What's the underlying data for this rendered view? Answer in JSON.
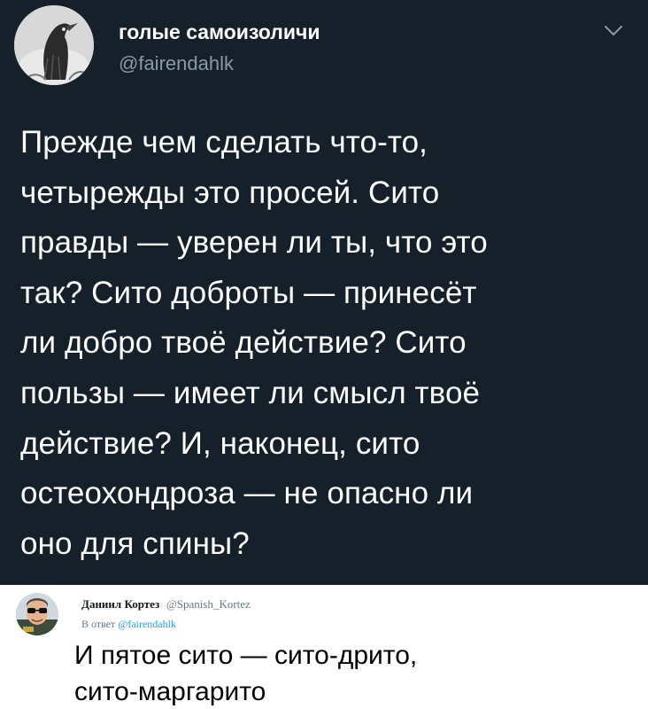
{
  "tweet": {
    "author": {
      "name": "голые самоизоличи",
      "handle": "@fairendahlk",
      "avatar_icon": "bird-avatar-icon"
    },
    "menu_icon": "chevron-down-icon",
    "text_lines": [
      "Прежде чем сделать что-то,",
      "четырежды это просей. Сито",
      "правды — уверен ли ты, что это",
      "так? Сито доброты — принесёт",
      "ли добро твоё действие? Сито",
      "пользы — имеет ли смысл твоё",
      "действие? И, наконец, сито",
      "остеохондроза — не опасно ли",
      "оно для спины?"
    ],
    "theme": {
      "background": "#15202b",
      "text": "#ffffff",
      "secondary": "#8b98a5"
    }
  },
  "reply": {
    "author": {
      "name": "Даниил Кортез",
      "handle": "@Spanish_Kortez",
      "avatar_icon": "sunglasses-person-avatar-icon"
    },
    "reply_to": {
      "prefix": "В ответ",
      "handle": "@fairendahlk"
    },
    "text_lines": [
      "И пятое сито — сито-дрито,",
      "сито-маргарито"
    ],
    "theme": {
      "background": "#ffffff",
      "text": "#000000",
      "secondary": "#657786",
      "link": "#1da1f2"
    }
  }
}
